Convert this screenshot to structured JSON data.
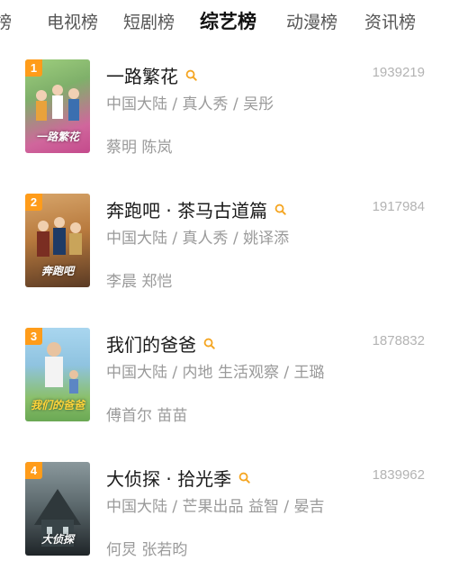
{
  "tabs": [
    {
      "label": "榜"
    },
    {
      "label": "电视榜"
    },
    {
      "label": "短剧榜"
    },
    {
      "label": "综艺榜"
    },
    {
      "label": "动漫榜"
    },
    {
      "label": "资讯榜"
    }
  ],
  "active_tab": "综艺榜",
  "items": [
    {
      "rank": "1",
      "title": "一路繁花",
      "count": "1939219",
      "meta": "中国大陆 / 真人秀 / 吴彤",
      "cast": "蔡明 陈岚",
      "poster_text": "一路繁花",
      "poster_colors": [
        "#7fb06a",
        "#c44a8c"
      ]
    },
    {
      "rank": "2",
      "title": "奔跑吧 · 茶马古道篇",
      "count": "1917984",
      "meta": "中国大陆 / 真人秀 / 姚译添",
      "cast": "李晨 郑恺",
      "poster_text": "奔跑吧",
      "poster_colors": [
        "#b87a3e",
        "#5a3a24"
      ]
    },
    {
      "rank": "3",
      "title": "我们的爸爸",
      "count": "1878832",
      "meta": "中国大陆 / 内地 生活观察 / 王璐",
      "cast": "傅首尔 苗苗",
      "poster_text": "我们的爸爸",
      "poster_colors": [
        "#8fc3e0",
        "#6aa854"
      ]
    },
    {
      "rank": "4",
      "title": "大侦探 · 拾光季",
      "count": "1839962",
      "meta": "中国大陆 / 芒果出品 益智 / 晏吉",
      "cast": "何炅 张若昀",
      "poster_text": "大侦探",
      "poster_colors": [
        "#5d6a6e",
        "#1f2528"
      ]
    }
  ],
  "colors": {
    "rank_badge": "#ff9c1a",
    "search_icon": "#f5a623",
    "meta_text": "#9a9a9a",
    "count_text": "#b3b3b3"
  }
}
